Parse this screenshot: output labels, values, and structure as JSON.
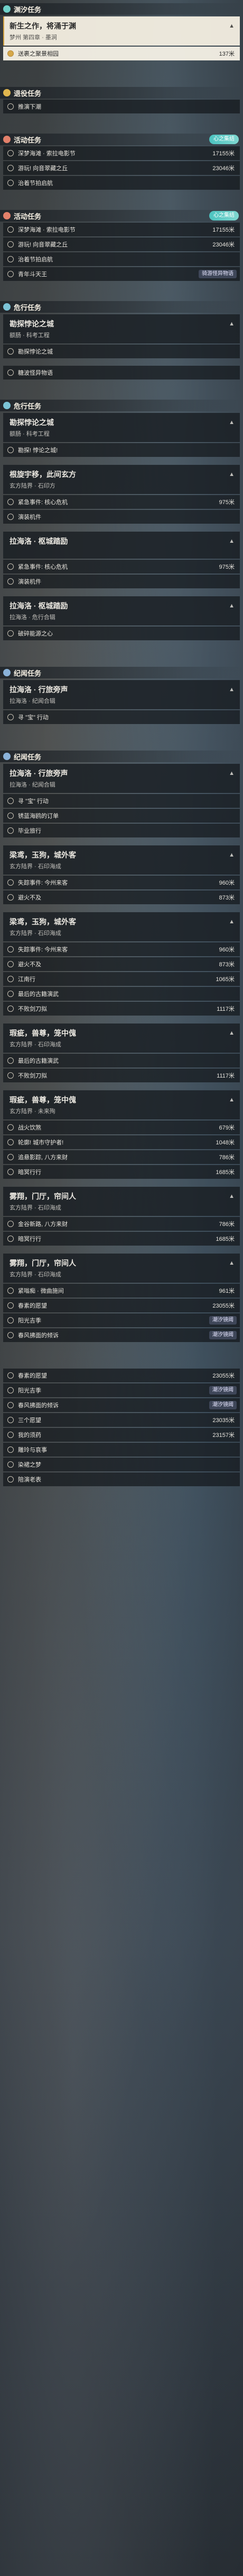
{
  "sections": [
    {
      "header": {
        "label": "渊汐任务",
        "color": "#6fd0c8",
        "icon": "gear-icon"
      },
      "cards": [
        {
          "title": "新生之作，将涌于渊",
          "sub": "梦州 第四章 · 墨涧",
          "objectives": [
            {
              "text": "送裹之聚景相园",
              "dist": "137米",
              "active": true
            }
          ]
        }
      ]
    },
    {
      "header": {
        "label": "退役任务",
        "color": "#e0b64e"
      },
      "cards": [],
      "objectives": [
        {
          "text": "推演下潮",
          "dist": ""
        }
      ]
    },
    {
      "header": {
        "label": "活动任务",
        "color": "#e2806a",
        "tag": "心之集结"
      },
      "cards": [],
      "objectives": [
        {
          "text": "深梦海滩 · 索拉电影节",
          "dist": "17155米"
        },
        {
          "text": "游玩! 向音翠藏之丘",
          "dist": "23046米"
        },
        {
          "text": "治着节拍启航",
          "dist": ""
        }
      ]
    },
    {
      "header": {
        "label": "活动任务",
        "color": "#e2806a",
        "tag": "心之集结"
      },
      "cards": [],
      "objectives": [
        {
          "text": "深梦海滩 · 索拉电影节",
          "dist": "17155米"
        },
        {
          "text": "游玩! 向音翠藏之丘",
          "dist": "23046米"
        },
        {
          "text": "治着节拍启航",
          "dist": ""
        },
        {
          "text": "青年斗天王",
          "dist": "6544米",
          "badge": "骑游怪异物语"
        }
      ]
    },
    {
      "header": {
        "label": "危行任务",
        "color": "#7bc3d6"
      },
      "cards": [
        {
          "title": "勘探悖论之城",
          "sub": "额肠 · 科考工程",
          "objectives": [
            {
              "text": "勘探悖论之城",
              "dist": ""
            }
          ]
        }
      ],
      "objectives": [
        {
          "text": "糖波怪异物语",
          "dist": ""
        }
      ]
    },
    {
      "header": {
        "label": "危行任务",
        "color": "#7bc3d6"
      },
      "cards": [
        {
          "title": "勘探悖论之城",
          "sub": "额肠 · 科考工程",
          "objectives": [
            {
              "text": "勘探! 悖论之城!",
              "dist": ""
            }
          ]
        },
        {
          "title": "根旋宇移，此间玄方",
          "sub": "玄方陆界 · 石印方",
          "objectives": [
            {
              "text": "紧急事件: 核心危机",
              "dist": "975米"
            },
            {
              "text": "演装机件",
              "dist": ""
            }
          ]
        },
        {
          "title": "拉海洛 · 枢城踏励",
          "sub": "",
          "objectives": [
            {
              "text": "紧急事件: 核心危机",
              "dist": "975米"
            },
            {
              "text": "演装机件",
              "dist": ""
            }
          ]
        },
        {
          "title": "拉海洛 · 枢城踏励",
          "sub": "拉海洛 · 危行合辑",
          "objectives": [
            {
              "text": "破碎能源之心",
              "dist": ""
            }
          ]
        }
      ]
    },
    {
      "header": {
        "label": "纪闻任务",
        "color": "#8ab2d9"
      },
      "cards": [
        {
          "title": "拉海洛 · 行旅旁声",
          "sub": "拉海洛 · 纪闻合辑",
          "objectives": [
            {
              "text": "寻 \"宝\" 行动",
              "dist": ""
            }
          ]
        }
      ]
    },
    {
      "header": {
        "label": "纪闻任务",
        "color": "#8ab2d9"
      },
      "cards": [
        {
          "title": "拉海洛 · 行旅旁声",
          "sub": "拉海洛 · 纪闻合辑",
          "objectives": [
            {
              "text": "寻 \"宝\" 行动",
              "dist": ""
            },
            {
              "text": "锈蓝海鸥的订单",
              "dist": ""
            },
            {
              "text": "毕业旅行",
              "dist": ""
            }
          ]
        },
        {
          "title": "梁鸢，玉狗，城外客",
          "sub": "玄方陆界 · 石印海成",
          "objectives": [
            {
              "text": "失踪事件: 今州来客",
              "dist": "960米"
            },
            {
              "text": "避火不及",
              "dist": "873米"
            }
          ]
        },
        {
          "title": "梁鸢，玉狗，城外客",
          "sub": "玄方陆界 · 石印海成",
          "objectives": [
            {
              "text": "失踪事件: 今州来客",
              "dist": "960米"
            },
            {
              "text": "避火不及",
              "dist": "873米"
            },
            {
              "text": "江南行",
              "dist": "1065米"
            },
            {
              "text": "最后的古籍演武",
              "dist": ""
            },
            {
              "text": "不败剑刀拟",
              "dist": "1117米"
            }
          ]
        },
        {
          "title": "瑕疵，兽尊，笼中傀",
          "sub": "玄方陆界 · 石印海成",
          "objectives": [
            {
              "text": "最后的古籍演武",
              "dist": ""
            },
            {
              "text": "不败剑刀拟",
              "dist": "1117米"
            }
          ]
        },
        {
          "title": "瑕疵，兽尊，笼中傀",
          "sub": "玄方陆界 · 未来殉",
          "objectives": [
            {
              "text": "战火饮煞",
              "dist": "679米"
            },
            {
              "text": "轮廓! 城市守护者!",
              "dist": "1048米"
            },
            {
              "text": "追悬影踪, 八方来财",
              "dist": "786米"
            },
            {
              "text": "暗冥行行",
              "dist": "1685米"
            }
          ]
        },
        {
          "title": "雾翔，门厅，帘间人",
          "sub": "玄方陆界 · 石印海成",
          "objectives": [
            {
              "text": "金谷新路, 八方来财",
              "dist": "786米"
            },
            {
              "text": "暗冥行行",
              "dist": "1685米"
            }
          ]
        },
        {
          "title": "雾翔，门厅，帘间人",
          "sub": "玄方陆界 · 石印海成",
          "objectives": [
            {
              "text": "紧嗡痴 · 微曲施间",
              "dist": "961米"
            },
            {
              "text": "春素的愿望",
              "dist": "23055米"
            },
            {
              "text": "阳光吉季",
              "dist": "",
              "badge": "潮汐镜阈"
            },
            {
              "text": "春风拂面的倾诉",
              "dist": "",
              "badge": "潮汐镜阈"
            }
          ]
        }
      ]
    },
    {
      "header": {
        "label": "",
        "color": "#8ab2d9"
      },
      "cards": [],
      "objectives": [
        {
          "text": "春素的愿望",
          "dist": "23055米"
        },
        {
          "text": "阳光吉季",
          "dist": "",
          "badge": "潮汐镜阈"
        },
        {
          "text": "春风拂面的倾诉",
          "dist": "",
          "badge": "潮汐镜阈"
        },
        {
          "text": "三个愿望",
          "dist": "23035米"
        },
        {
          "text": "我的须药",
          "dist": "23157米"
        },
        {
          "text": "雕玲与哀事",
          "dist": ""
        },
        {
          "text": "染裙之梦",
          "dist": ""
        },
        {
          "text": "陪演老表",
          "dist": ""
        }
      ]
    }
  ]
}
